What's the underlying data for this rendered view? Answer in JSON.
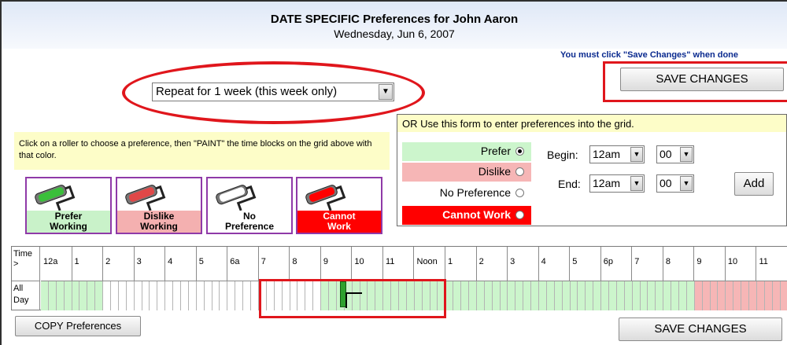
{
  "header": {
    "title": "DATE SPECIFIC Preferences for John Aaron",
    "subtitle": "Wednesday, Jun 6, 2007"
  },
  "notice": "You must click \"Save Changes\" when done",
  "buttons": {
    "save_top": "SAVE CHANGES",
    "save_bottom": "SAVE CHANGES",
    "copy": "COPY Preferences",
    "add": "Add"
  },
  "repeat": {
    "selected": "Repeat for 1 week (this week only)"
  },
  "instructions": "Click on a roller to choose a preference, then \"PAINT\" the time blocks on the grid above with that color.",
  "rollers": [
    {
      "line1": "Prefer",
      "line2": "Working",
      "color": "#c9f2c9",
      "paint": "#3bbf3b",
      "text_color": "#000000"
    },
    {
      "line1": "Dislike",
      "line2": "Working",
      "color": "#f4b0b0",
      "paint": "#e04848",
      "text_color": "#000000"
    },
    {
      "line1": "No",
      "line2": "Preference",
      "color": "#ffffff",
      "paint": "#ffffff",
      "text_color": "#000000"
    },
    {
      "line1": "Cannot",
      "line2": "Work",
      "color": "#ff0000",
      "paint": "#ff0000",
      "text_color": "#ffffff"
    }
  ],
  "form": {
    "heading": "OR Use this form to enter preferences into the grid.",
    "options": [
      {
        "label": "Prefer",
        "bg": "#ccf5cc",
        "text_color": "#000000",
        "checked": true
      },
      {
        "label": "Dislike",
        "bg": "#f6b6b6",
        "text_color": "#000000",
        "checked": false
      },
      {
        "label": "No Preference",
        "bg": "#ffffff",
        "text_color": "#000000",
        "checked": false
      },
      {
        "label": "Cannot Work",
        "bg": "#ff0000",
        "text_color": "#ffffff",
        "checked": false
      }
    ],
    "begin_label": "Begin:",
    "end_label": "End:",
    "begin_hour": "12am",
    "begin_min": "00",
    "end_hour": "12am",
    "end_min": "00"
  },
  "grid": {
    "time_label": "Time >",
    "allday_label": "All Day",
    "hours": [
      "12a",
      "1",
      "2",
      "3",
      "4",
      "5",
      "6a",
      "7",
      "8",
      "9",
      "10",
      "11",
      "Noon",
      "1",
      "2",
      "3",
      "4",
      "5",
      "6p",
      "7",
      "8",
      "9",
      "10",
      "11"
    ],
    "hour_states": [
      "prefer",
      "prefer",
      "none",
      "none",
      "none",
      "none",
      "none",
      "none",
      "none",
      "prefer",
      "prefer",
      "prefer",
      "prefer",
      "prefer",
      "prefer",
      "prefer",
      "prefer",
      "prefer",
      "prefer",
      "prefer",
      "prefer",
      "dislike",
      "dislike",
      "dislike"
    ]
  },
  "colors": {
    "prefer": "#ccf5cc",
    "dislike": "#f6b6b6",
    "none": "#ffffff",
    "accent_red": "#e0161c"
  }
}
